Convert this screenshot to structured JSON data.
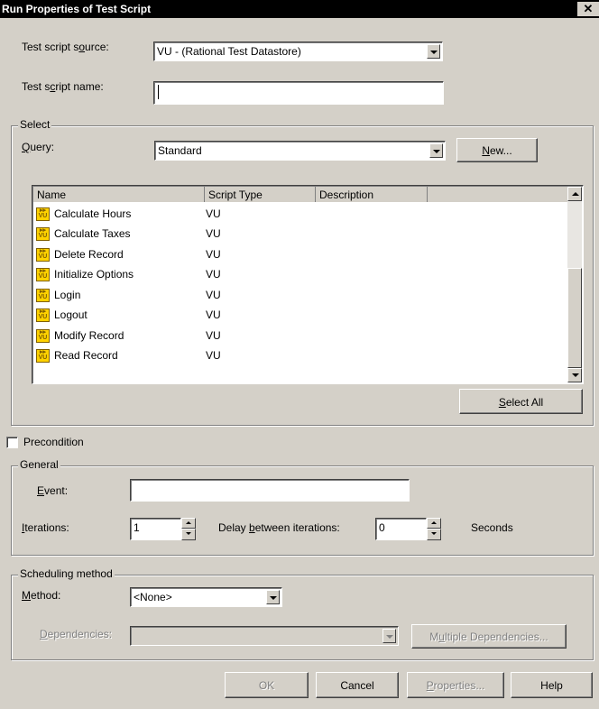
{
  "window": {
    "title": "Run Properties of Test Script",
    "close_glyph": "✕"
  },
  "source": {
    "label": "Test script source:",
    "value": "VU  - (Rational Test Datastore)"
  },
  "script_name": {
    "label": "Test script name:",
    "value": ""
  },
  "select": {
    "group_label": "Select",
    "query_label": "Query:",
    "query_value": "Standard",
    "new_button": "New...",
    "columns": [
      "Name",
      "Script Type",
      "Description"
    ],
    "scripts": [
      {
        "name": "Calculate Hours",
        "type": "VU",
        "icon": "vu-script-icon"
      },
      {
        "name": "Calculate Taxes",
        "type": "VU",
        "icon": "vu-script-icon"
      },
      {
        "name": "Delete Record",
        "type": "VU",
        "icon": "vu-script-icon"
      },
      {
        "name": "Initialize Options",
        "type": "VU",
        "icon": "vu-script-icon"
      },
      {
        "name": "Login",
        "type": "VU",
        "icon": "vu-script-icon"
      },
      {
        "name": "Logout",
        "type": "VU",
        "icon": "vu-script-icon"
      },
      {
        "name": "Modify Record",
        "type": "VU",
        "icon": "vu-script-icon"
      },
      {
        "name": "Read Record",
        "type": "VU",
        "icon": "vu-script-icon"
      }
    ],
    "select_all_button": "Select All"
  },
  "precondition": {
    "label": "Precondition",
    "checked": false
  },
  "general": {
    "group_label": "General",
    "event_label": "Event:",
    "event_value": "",
    "iterations_label": "Iterations:",
    "iterations_value": "1",
    "delay_label": "Delay between iterations:",
    "delay_value": "0",
    "seconds_label": "Seconds"
  },
  "scheduling": {
    "group_label": "Scheduling method",
    "method_label": "Method:",
    "method_value": "<None>",
    "dependencies_label": "Dependencies:",
    "dependencies_value": "",
    "multiple_dependencies_button": "Multiple Dependencies..."
  },
  "buttons": {
    "ok": "OK",
    "cancel": "Cancel",
    "properties": "Properties...",
    "help": "Help"
  },
  "colors": {
    "face": "#d4d0c8",
    "titlebar": "#000000",
    "icon": "#ffd200"
  }
}
